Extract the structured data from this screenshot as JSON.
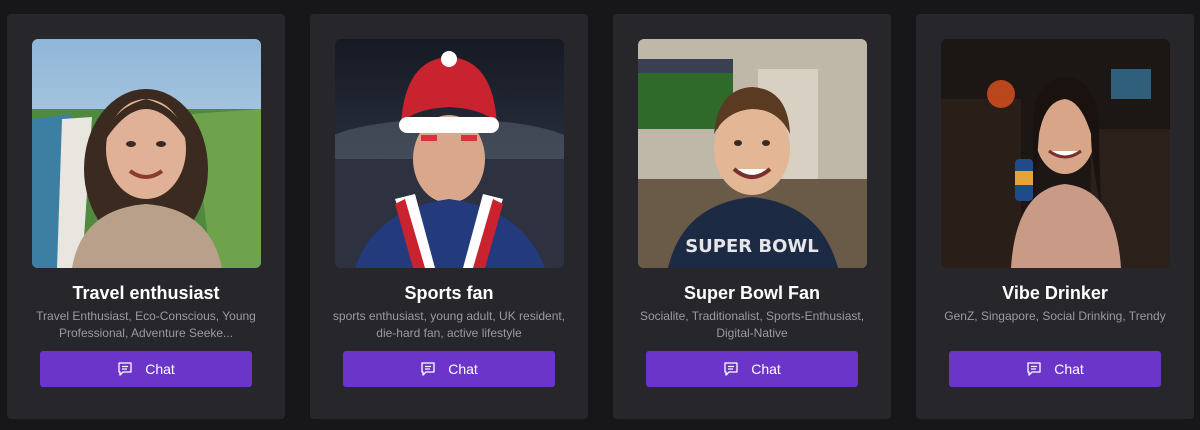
{
  "personas": [
    {
      "name": "Travel enthusiast",
      "tags": "Travel Enthusiast, Eco-Conscious, Young Professional, Adventure Seeke...",
      "button_label": "Chat",
      "icon": "chat-icon",
      "avatar_description": "woman smiling on coastal cliffs"
    },
    {
      "name": "Sports fan",
      "tags": "sports enthusiast, young adult, UK resident, die-hard fan, active lifestyle",
      "button_label": "Chat",
      "icon": "chat-icon",
      "avatar_description": "man with face paint and scarf in stadium"
    },
    {
      "name": "Super Bowl Fan",
      "tags": "Socialite, Traditionalist, Sports-Enthusiast, Digital-Native",
      "button_label": "Chat",
      "icon": "chat-icon",
      "avatar_description": "smiling man in Super Bowl shirt"
    },
    {
      "name": "Vibe Drinker",
      "tags": "GenZ, Singapore, Social Drinking, Trendy",
      "button_label": "Chat",
      "icon": "chat-icon",
      "avatar_description": "woman holding drink in a bar"
    }
  ],
  "colors": {
    "background": "#17171a",
    "card": "#26262b",
    "accent": "#6c35c9",
    "tag_text": "#9a9aa3"
  }
}
